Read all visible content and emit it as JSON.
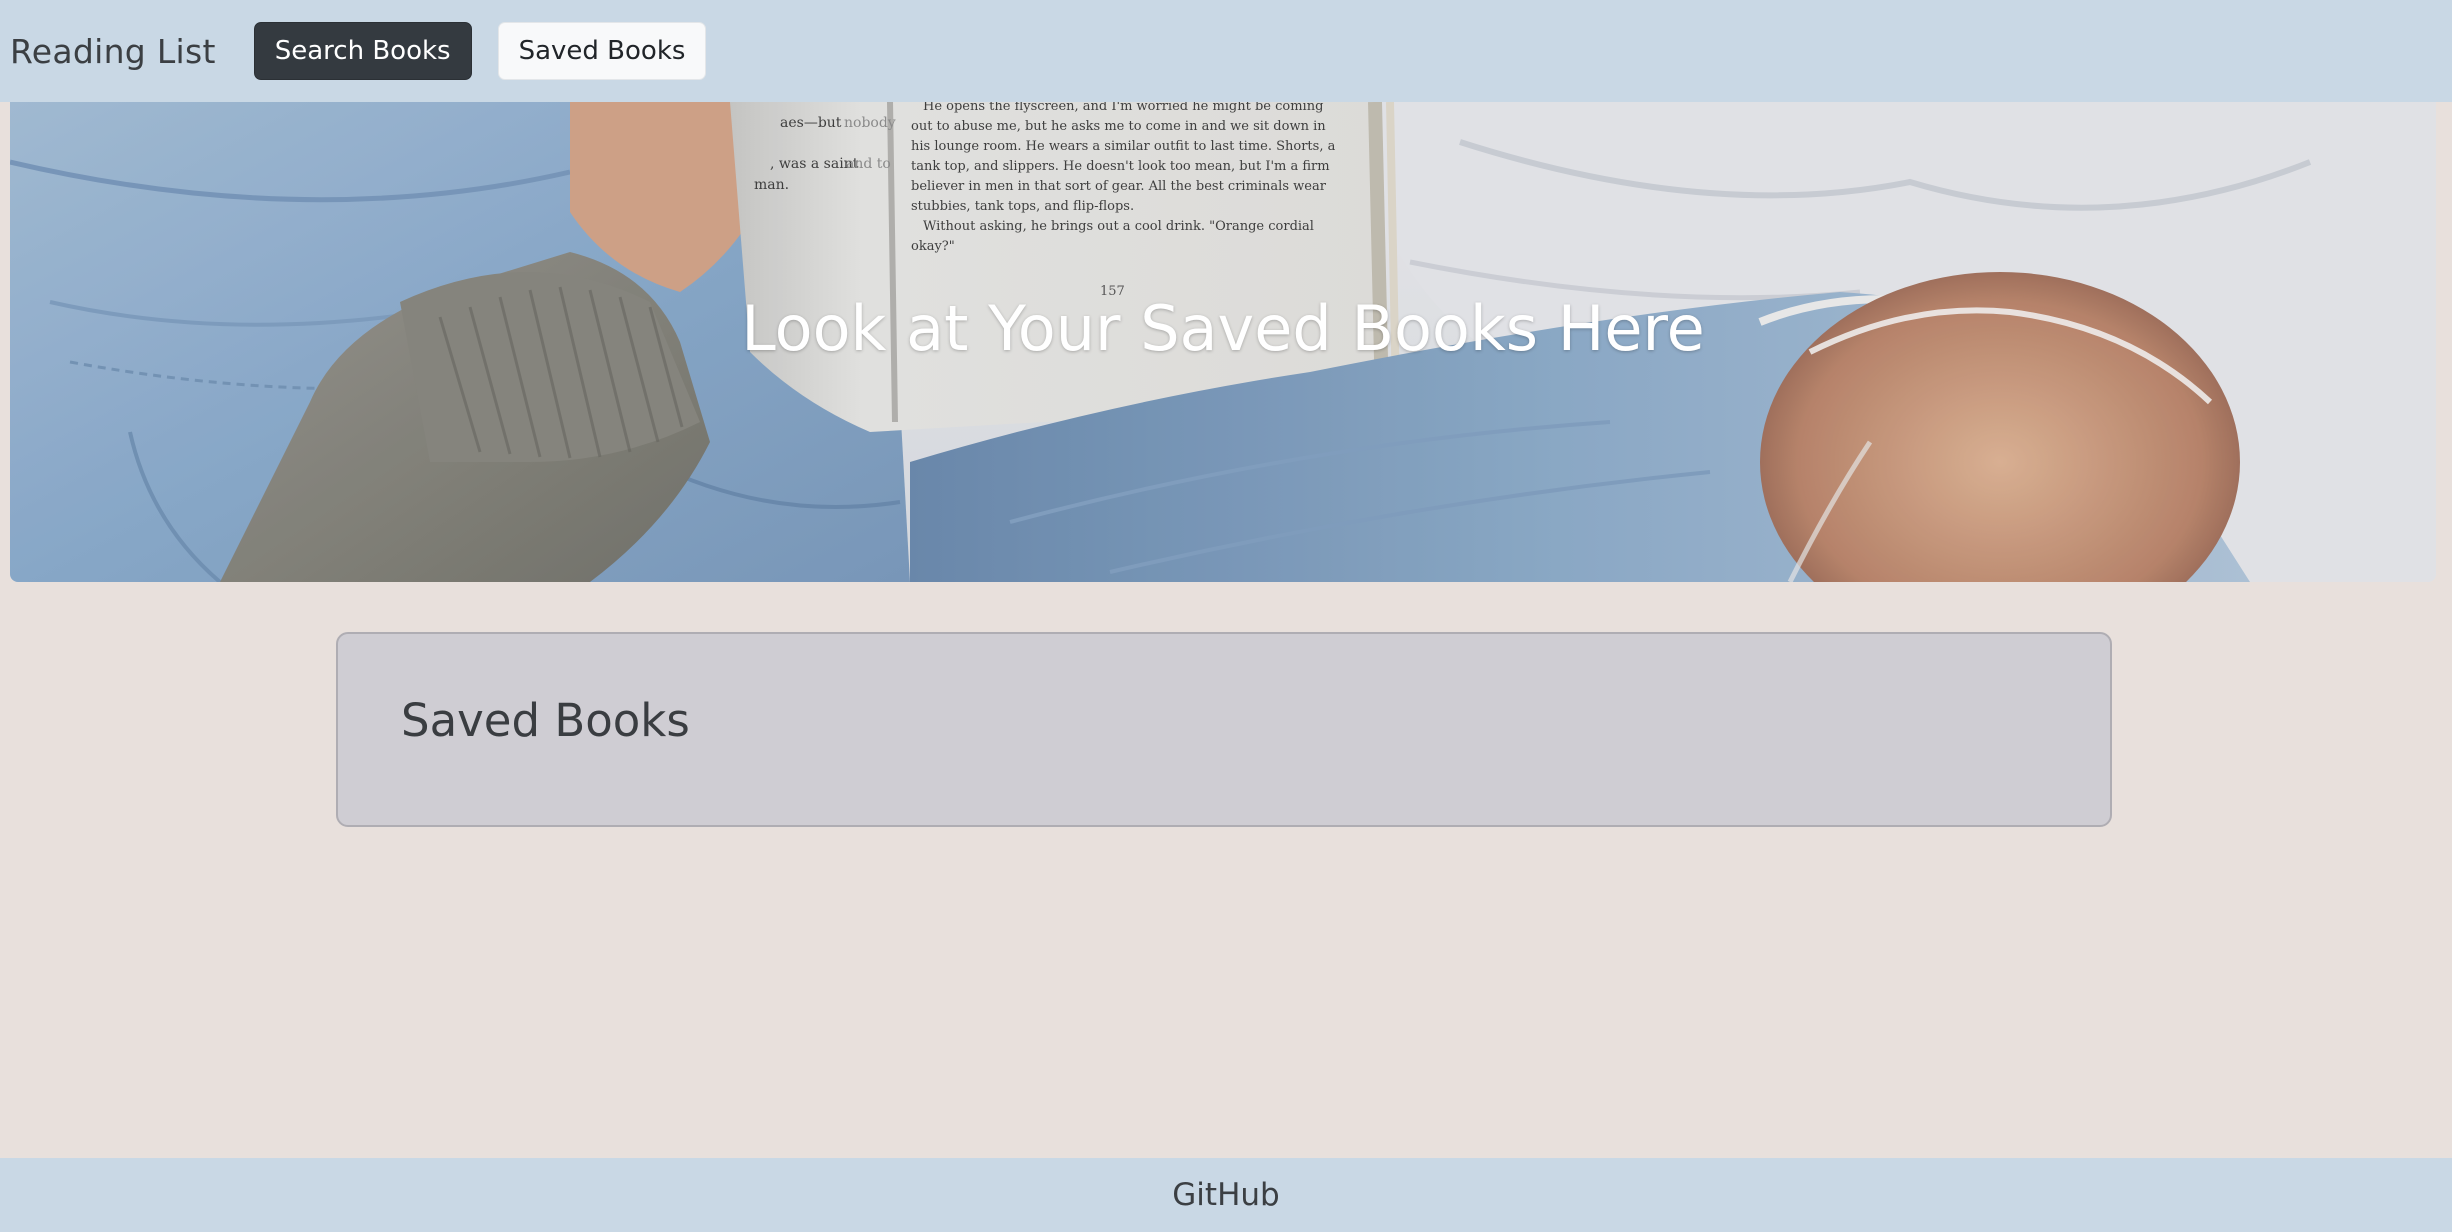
{
  "navbar": {
    "brand": "Reading List",
    "search_label": "Search Books",
    "saved_label": "Saved Books"
  },
  "hero": {
    "title": "Look at Your Saved Books Here",
    "book_text": {
      "left_frag_1": "aes—but",
      "left_frag_1b": "nobody",
      "left_frag_2": ", was a saint",
      "left_frag_2b": "and to",
      "left_frag_3": "man.",
      "lines": [
        "He opens the flyscreen, and I'm worried he might be coming",
        "out to abuse me, but he asks me to come in and we sit down in",
        "his lounge room. He wears a similar outfit to last time. Shorts, a",
        "tank top, and slippers. He doesn't look too mean, but I'm a firm",
        "believer in men in that sort of gear. All the best criminals wear",
        "stubbies, tank tops, and flip-flops.",
        "Without asking, he brings out a cool drink. \"Orange cordial",
        "okay?\""
      ],
      "page_number": "157"
    }
  },
  "card": {
    "title": "Saved Books"
  },
  "footer": {
    "link": "GitHub"
  },
  "colors": {
    "navbar_bg": "#c9d8e5",
    "page_bg": "#e8e0dc",
    "card_bg": "#cfcdd3",
    "dark_button": "#343a40",
    "light_button": "#f8f9fa"
  }
}
